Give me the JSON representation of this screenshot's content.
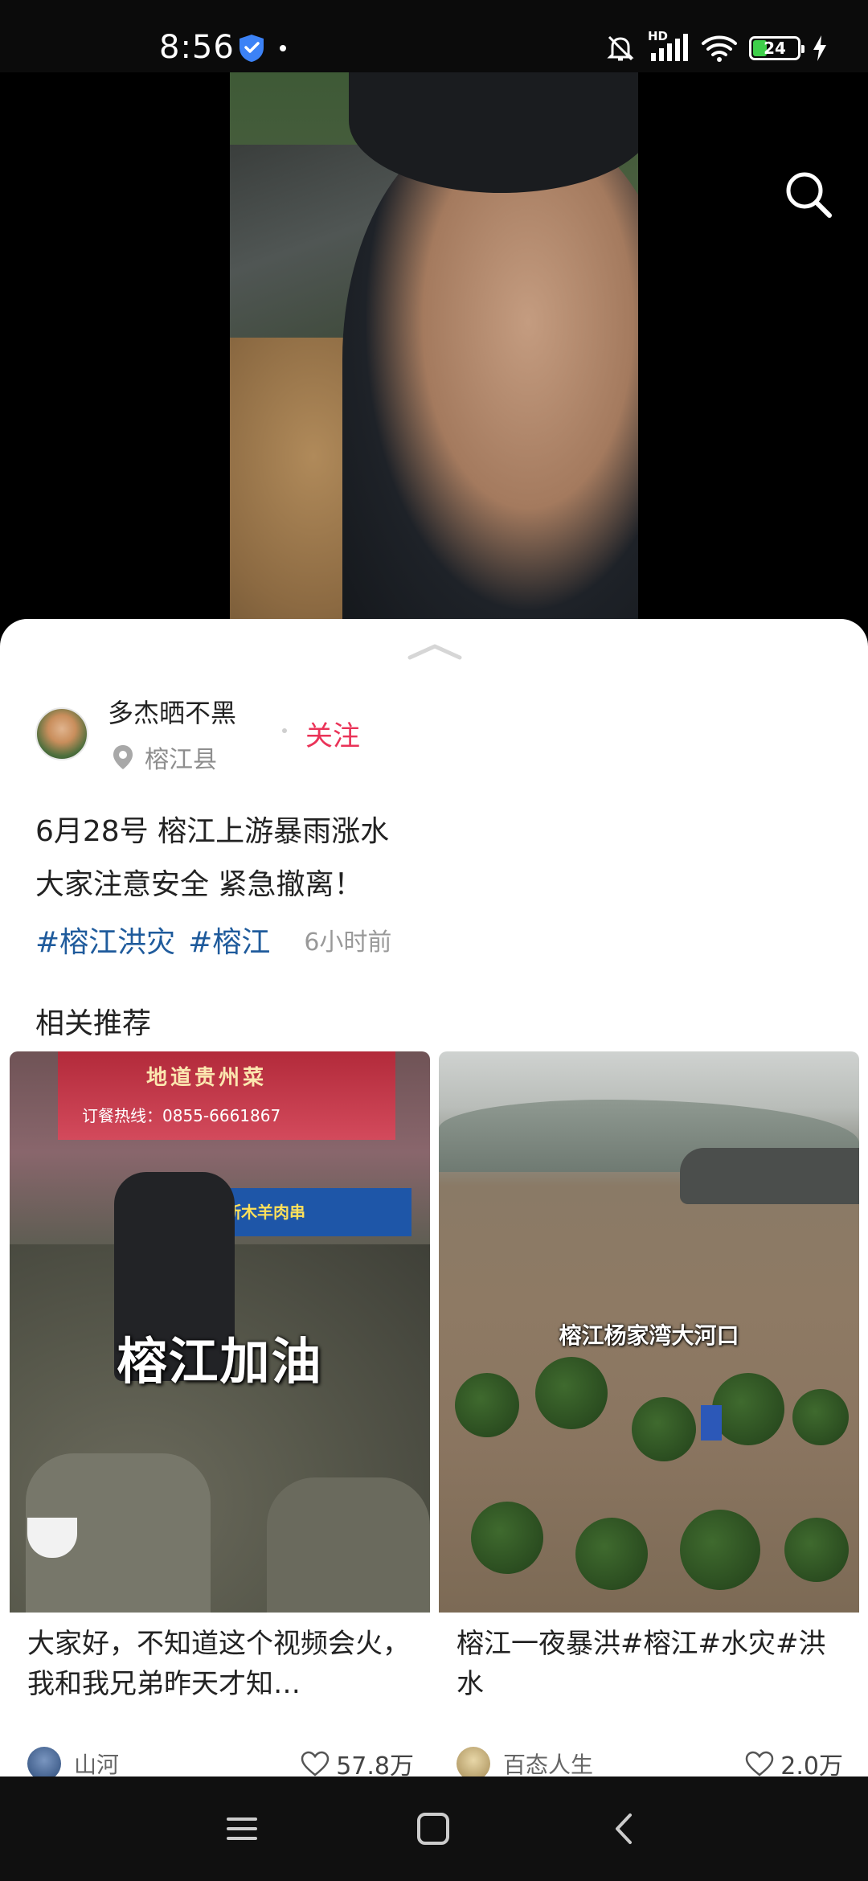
{
  "status_bar": {
    "time": "8:56",
    "network": "HD",
    "battery": "24",
    "icons": [
      "shield-icon",
      "mute-icon",
      "signal-icon",
      "wifi-icon",
      "battery-icon",
      "charging-icon"
    ]
  },
  "video": {
    "icons": [
      "search-icon"
    ]
  },
  "sheet": {
    "author": {
      "name": "多杰晒不黑",
      "location": "榕江县",
      "follow_label": "关注"
    },
    "description_lines": [
      "6月28号 榕江上游暴雨涨水",
      "大家注意安全 紧急撤离！"
    ],
    "tags": [
      "#榕江洪灾",
      "#榕江"
    ],
    "time_ago": "6小时前",
    "section_title": "相关推荐",
    "cards": [
      {
        "overlay_text": "榕江加油",
        "title": "大家好，不知道这个视频会火，我和我兄弟昨天才知…",
        "author": "山河",
        "likes": "57.8万",
        "sign_texts": [
          "地道贵州菜",
          "订餐热线：0855-6661867",
          "新疆喀斯木羊肉串"
        ]
      },
      {
        "overlay_text": "榕江杨家湾大河口",
        "title": "榕江一夜暴洪#榕江#水灾#洪水",
        "author": "百态人生",
        "likes": "2.0万"
      }
    ]
  },
  "nav_bar": {
    "icons": [
      "menu-icon",
      "home-icon",
      "back-icon"
    ]
  },
  "colors": {
    "follow": "#ea3358",
    "tag": "#1f5b9c",
    "battery_fill": "#3ecf4a"
  }
}
